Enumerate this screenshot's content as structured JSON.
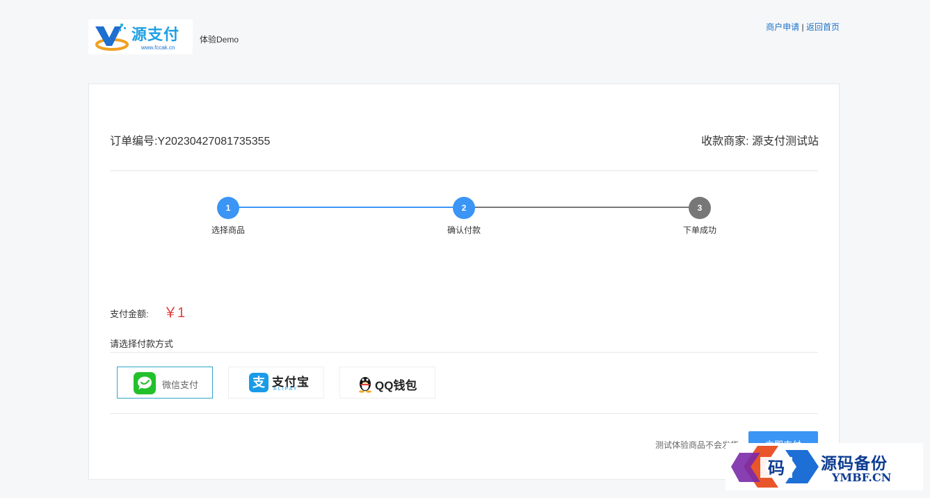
{
  "header": {
    "logo_text": "源支付",
    "logo_url": "www.fccak.cn",
    "subtitle": "体验Demo",
    "link_merchant": "商户申请",
    "separator": "|",
    "link_home": "返回首页"
  },
  "order": {
    "number_label": "订单编号:Y20230427081735355",
    "merchant_label": "收款商家: 源支付测试站"
  },
  "steps": [
    {
      "num": "1",
      "label": "选择商品",
      "status": "done"
    },
    {
      "num": "2",
      "label": "确认付款",
      "status": "current"
    },
    {
      "num": "3",
      "label": "下单成功",
      "status": "pending"
    }
  ],
  "colors": {
    "accent": "#3a95f5",
    "pending": "#777777",
    "amount": "#e43c3c",
    "wechat": "#22c02b",
    "alipay": "#1a9be8"
  },
  "payment": {
    "amount_label": "支付金额:",
    "amount_value": "￥1",
    "choose_label": "请选择付款方式",
    "methods": [
      {
        "name": "微信支付",
        "icon": "wechat-icon",
        "selected": true
      },
      {
        "name": "支付宝",
        "sub": "ALIPAY",
        "icon": "alipay-icon",
        "selected": false
      },
      {
        "name": "QQ钱包",
        "icon": "qq-penguin-icon",
        "selected": false
      }
    ],
    "note": "测试体验商品不会发货",
    "pay_button": "立即支付"
  },
  "watermark": {
    "glyph": "码",
    "cn": "源码备份",
    "en": "YMBF.CN"
  }
}
